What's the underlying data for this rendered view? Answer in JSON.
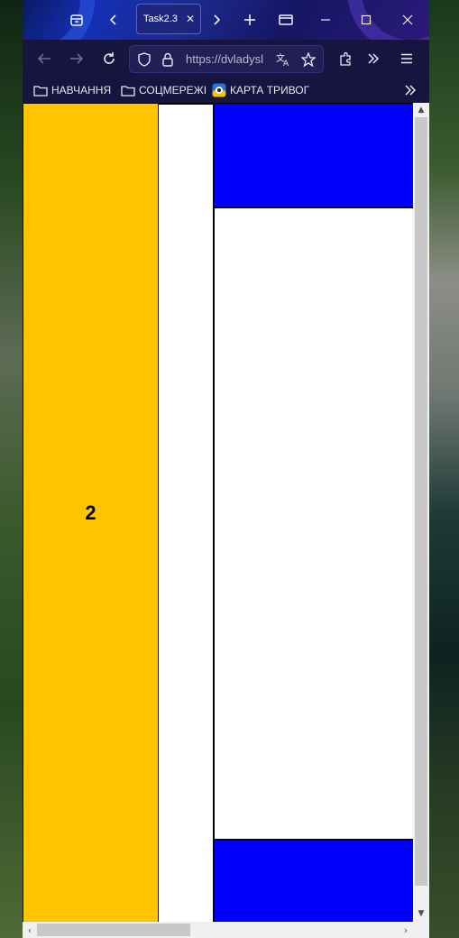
{
  "browser": {
    "tab": {
      "title": "Task2.3"
    },
    "url": "https://dvladysl",
    "bookmarks": [
      {
        "label": "НАВЧАННЯ",
        "icon": "folder-icon"
      },
      {
        "label": "СОЦМЕРЕЖІ",
        "icon": "folder-icon"
      },
      {
        "label": "КАРТА ТРИВОГ",
        "icon": "alert-map-icon"
      }
    ],
    "theme": {
      "titlebar": "#1330b5",
      "toolbar": "#16153f"
    }
  },
  "page": {
    "yellow_box_label": "2",
    "colors": {
      "yellow": "#ffc400",
      "blue": "#0000ff",
      "background": "#ffffff"
    }
  }
}
